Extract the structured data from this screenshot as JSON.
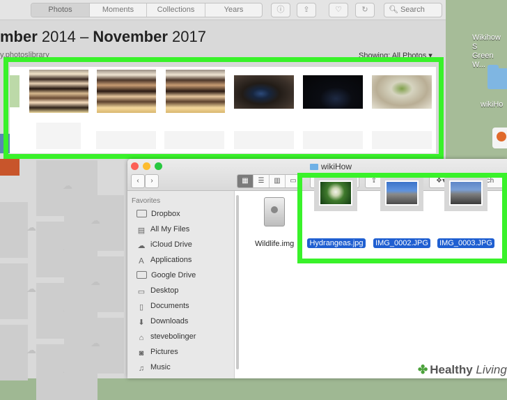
{
  "desktop": {
    "item1_line1": "Wikihow S",
    "item1_line2": "Green W...",
    "item2": "wikiHo"
  },
  "photos": {
    "tabs": [
      "Photos",
      "Moments",
      "Collections",
      "Years"
    ],
    "search_placeholder": "Search",
    "date_start_bold": "mber",
    "date_start_rest": " 2014 – ",
    "date_end_bold": "November",
    "date_end_rest": " 2017",
    "library": "y.photoslibrary",
    "showing": "Showing: All Photos ▾"
  },
  "finder": {
    "title": "wikiHow",
    "search_placeholder": "Search",
    "favorites_label": "Favorites",
    "sidebar": [
      {
        "label": "Dropbox",
        "icon": "folder-icon"
      },
      {
        "label": "All My Files",
        "icon": "files-icon"
      },
      {
        "label": "iCloud Drive",
        "icon": "cloud-icon"
      },
      {
        "label": "Applications",
        "icon": "applications-icon"
      },
      {
        "label": "Google Drive",
        "icon": "folder-icon"
      },
      {
        "label": "Desktop",
        "icon": "desktop-icon"
      },
      {
        "label": "Documents",
        "icon": "documents-icon"
      },
      {
        "label": "Downloads",
        "icon": "downloads-icon"
      },
      {
        "label": "stevebolinger",
        "icon": "home-icon"
      },
      {
        "label": "Pictures",
        "icon": "camera-icon"
      },
      {
        "label": "Music",
        "icon": "music-icon"
      }
    ],
    "files": [
      {
        "name": "Wildlife.img",
        "selected": false
      },
      {
        "name": "Hydrangeas.jpg",
        "selected": true
      },
      {
        "name": "IMG_0002.JPG",
        "selected": true
      },
      {
        "name": "IMG_0003.JPG",
        "selected": true
      }
    ]
  },
  "watermark": {
    "brand_bold": "Healthy",
    "brand_italic": " Living"
  },
  "colors": {
    "highlight": "#39f22a",
    "selection": "#1f5fd1"
  }
}
